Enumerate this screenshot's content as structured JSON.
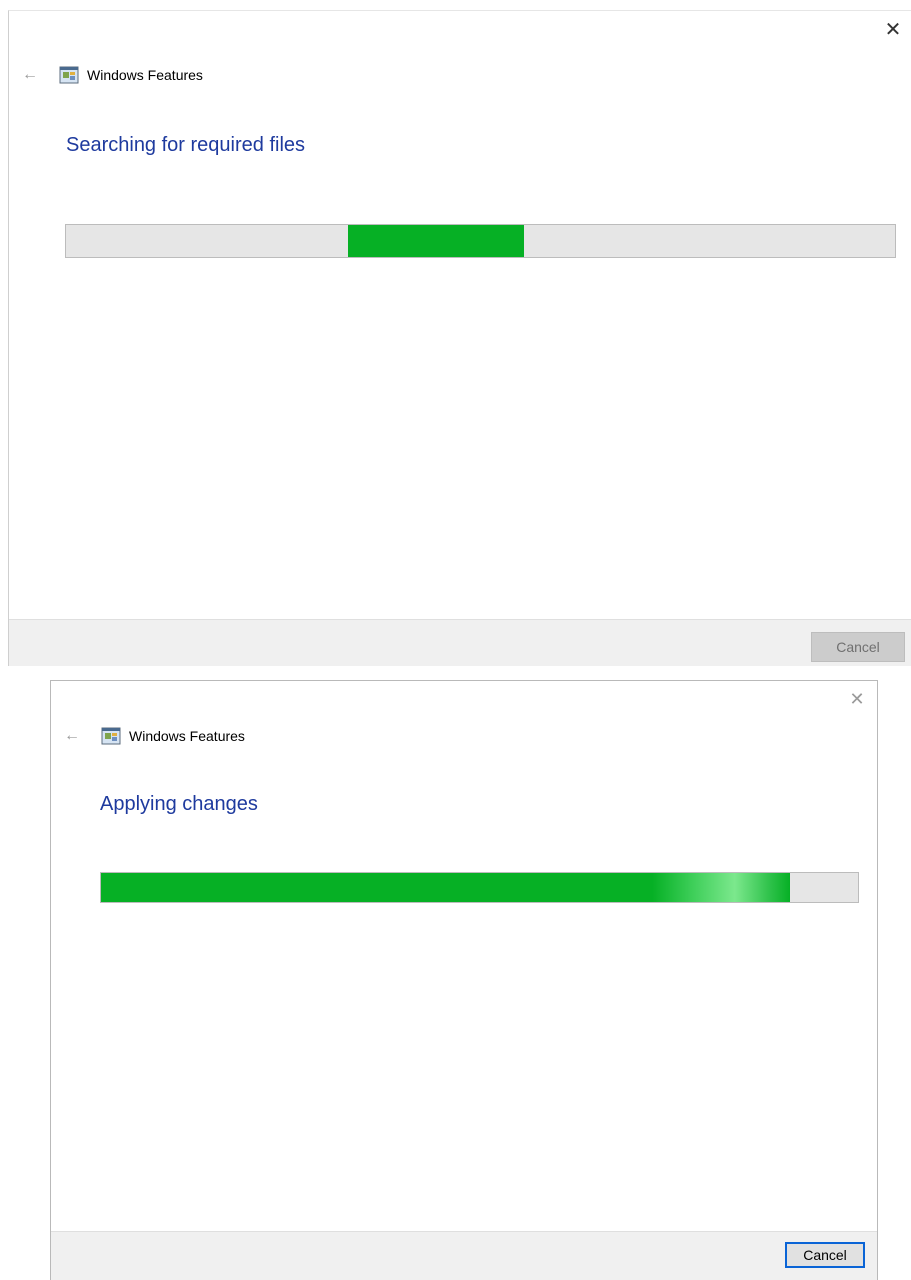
{
  "dialog1": {
    "title": "Windows Features",
    "status": "Searching for required files",
    "progress_mode": "indeterminate",
    "cancel_label": "Cancel",
    "cancel_enabled": false
  },
  "dialog2": {
    "title": "Windows Features",
    "status": "Applying changes",
    "progress": 0.91,
    "cancel_label": "Cancel",
    "cancel_enabled": true
  },
  "icons": {
    "close": "close-icon",
    "back": "back-arrow-icon",
    "app": "windows-features-icon"
  },
  "colors": {
    "progress_fill": "#06b025",
    "status_text": "#1e3a9e",
    "focus_border": "#0a64d6"
  }
}
